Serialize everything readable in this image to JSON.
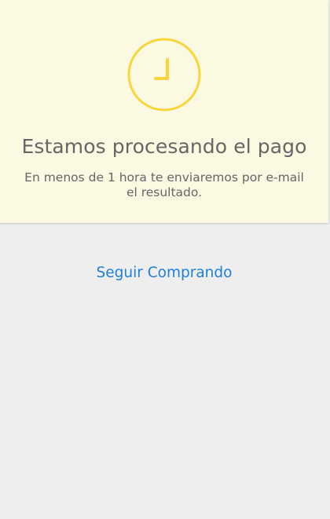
{
  "status": {
    "icon": "clock-icon",
    "title": "Estamos procesando el pago",
    "message": "En menos de 1 hora te enviaremos por e-mail el resultado.",
    "background_color": "#fbf9e2",
    "icon_color": "#f8d63a"
  },
  "actions": {
    "continue_label": "Seguir Comprando",
    "link_color": "#1d7fd8"
  }
}
